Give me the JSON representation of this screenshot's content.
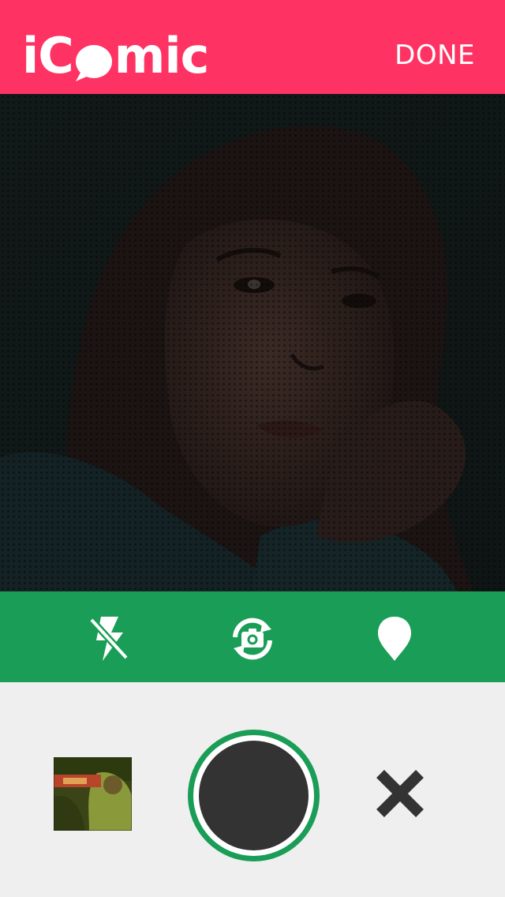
{
  "header": {
    "logo_prefix": "iC",
    "logo_suffix": "mic",
    "done_label": "DONE"
  },
  "colors": {
    "header_bg": "#ff3363",
    "controls_bg": "#1a9d56",
    "bottom_bg": "#efefef",
    "shutter_core": "#333333"
  },
  "controls": {
    "items": [
      {
        "icon": "flash-off-icon"
      },
      {
        "icon": "switch-camera-icon"
      },
      {
        "icon": "location-pin-icon"
      }
    ]
  },
  "bottom": {
    "thumbnail_icon": "last-photo-thumbnail",
    "shutter_icon": "shutter-button",
    "close_icon": "close-icon"
  }
}
